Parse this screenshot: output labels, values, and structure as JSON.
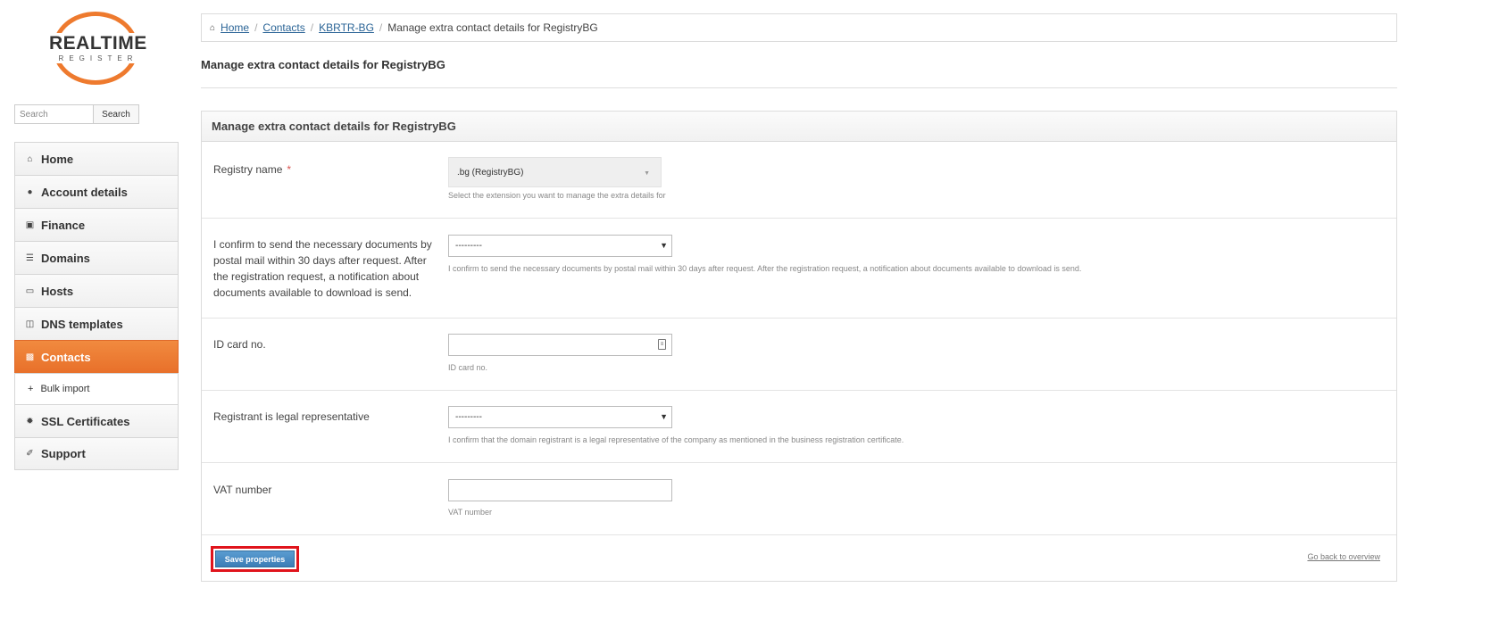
{
  "logo": {
    "word": "REALTIME",
    "sub": "REGISTER"
  },
  "search": {
    "placeholder": "Search",
    "button_label": "Search"
  },
  "sidebar": {
    "items": [
      {
        "label": "Home",
        "icon": "home-icon"
      },
      {
        "label": "Account details",
        "icon": "user-icon"
      },
      {
        "label": "Finance",
        "icon": "money-icon"
      },
      {
        "label": "Domains",
        "icon": "list-icon"
      },
      {
        "label": "Hosts",
        "icon": "hdd-icon"
      },
      {
        "label": "DNS templates",
        "icon": "columns-icon"
      },
      {
        "label": "Contacts",
        "icon": "book-icon",
        "active": true
      },
      {
        "label": "Bulk import",
        "icon": "plus-icon",
        "sub": true
      },
      {
        "label": "SSL Certificates",
        "icon": "certificate-icon"
      },
      {
        "label": "Support",
        "icon": "wrench-icon"
      }
    ]
  },
  "breadcrumb": {
    "home": "Home",
    "contacts": "Contacts",
    "handle": "KBRTR-BG",
    "current": "Manage extra contact details for RegistryBG"
  },
  "page": {
    "title": "Manage extra contact details for RegistryBG"
  },
  "panel": {
    "title": "Manage extra contact details for RegistryBG",
    "fields": {
      "registry": {
        "label": "Registry name",
        "required_mark": "*",
        "value": ".bg (RegistryBG)",
        "help": "Select the extension you want to manage the extra details for"
      },
      "confirm_docs": {
        "label": "I confirm to send the necessary documents by postal mail within 30 days after request. After the registration request, a notification about documents available to download is send.",
        "value": "---------",
        "help": "I confirm to send the necessary documents by postal mail within 30 days after request. After the registration request, a notification about documents available to download is send."
      },
      "id_card": {
        "label": "ID card no.",
        "value": "",
        "help": "ID card no."
      },
      "legal_rep": {
        "label": "Registrant is legal representative",
        "value": "---------",
        "help": "I confirm that the domain registrant is a legal representative of the company as mentioned in the business registration certificate."
      },
      "vat": {
        "label": "VAT number",
        "value": "",
        "help": "VAT number"
      }
    },
    "save_label": "Save properties",
    "back_label": "Go back to overview"
  },
  "colors": {
    "accent_orange": "#ee7a2e",
    "link_blue": "#2a6496",
    "button_blue": "#4a8cc4",
    "highlight_red": "#e0141c"
  }
}
